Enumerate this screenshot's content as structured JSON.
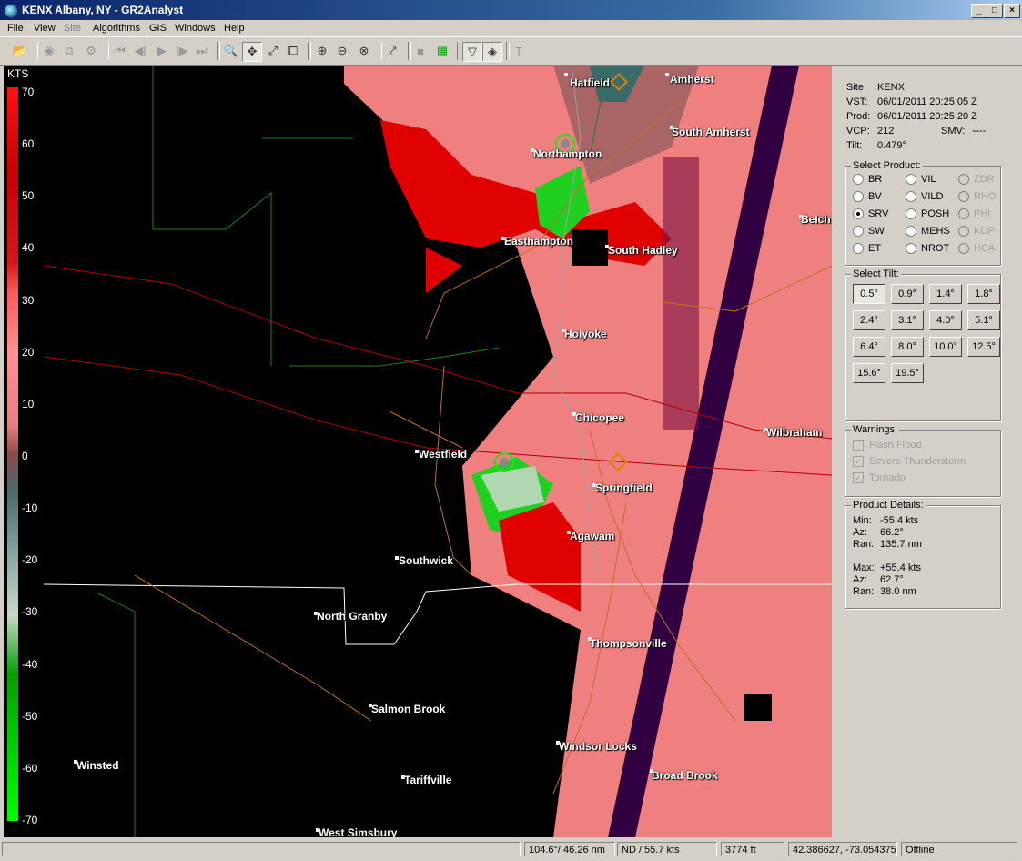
{
  "window": {
    "title": "KENX Albany, NY - GR2Analyst"
  },
  "menu": [
    "File",
    "View",
    "Site",
    "Algorithms",
    "GIS",
    "Windows",
    "Help"
  ],
  "legend": {
    "unit": "KTS",
    "ticks": [
      "70",
      "60",
      "50",
      "40",
      "30",
      "20",
      "10",
      "0",
      "-10",
      "-20",
      "-30",
      "-40",
      "-50",
      "-60",
      "-70"
    ]
  },
  "cities": [
    "Hatfield",
    "Amherst",
    "South Amherst",
    "Northampton",
    "Belch",
    "Easthampton",
    "South Hadley",
    "Holyoke",
    "Chicopee",
    "Wilbraham",
    "Westfield",
    "Springfield",
    "Agawam",
    "Southwick",
    "North Granby",
    "Thompsonville",
    "Salmon Brook",
    "Winsted",
    "Windsor Locks",
    "Tariffville",
    "Broad Brook",
    "West Simsbury"
  ],
  "info": {
    "site_label": "Site:",
    "site": "KENX",
    "vst_label": "VST:",
    "vst": "06/01/2011  20:25:05 Z",
    "prod_label": "Prod:",
    "prod": "06/01/2011  20:25:20 Z",
    "vcp_label": "VCP:",
    "vcp": "212",
    "smv_label": "SMV:",
    "smv": "----",
    "tilt_label": "Tilt:",
    "tilt": "0.479°"
  },
  "select_product": {
    "title": "Select Product:",
    "options": [
      {
        "label": "BR",
        "state": "normal"
      },
      {
        "label": "VIL",
        "state": "normal"
      },
      {
        "label": "ZDR",
        "state": "disabled"
      },
      {
        "label": "BV",
        "state": "normal"
      },
      {
        "label": "VILD",
        "state": "normal"
      },
      {
        "label": "RHO",
        "state": "disabled"
      },
      {
        "label": "SRV",
        "state": "selected"
      },
      {
        "label": "POSH",
        "state": "normal"
      },
      {
        "label": "PHI",
        "state": "disabled"
      },
      {
        "label": "SW",
        "state": "normal"
      },
      {
        "label": "MEHS",
        "state": "normal"
      },
      {
        "label": "KDP",
        "state": "disabled"
      },
      {
        "label": "ET",
        "state": "normal"
      },
      {
        "label": "NROT",
        "state": "normal"
      },
      {
        "label": "HCA",
        "state": "disabled"
      }
    ]
  },
  "select_tilt": {
    "title": "Select Tilt:",
    "tilts": [
      "0.5°",
      "0.9°",
      "1.4°",
      "1.8°",
      "2.4°",
      "3.1°",
      "4.0°",
      "5.1°",
      "6.4°",
      "8.0°",
      "10.0°",
      "12.5°",
      "15.6°",
      "19.5°"
    ],
    "selected": "0.5°"
  },
  "warnings": {
    "title": "Warnings:",
    "items": [
      {
        "label": "Flash Flood",
        "checked": false
      },
      {
        "label": "Severe Thunderstorm",
        "checked": true
      },
      {
        "label": "Tornado",
        "checked": true
      }
    ]
  },
  "product_details": {
    "title": "Product Details:",
    "min_label": "Min:",
    "min": "-55.4 kts",
    "az1_label": "Az:",
    "az1": "66.2°",
    "ran1_label": "Ran:",
    "ran1": "135.7 nm",
    "max_label": "Max:",
    "max": "+55.4 kts",
    "az2_label": "Az:",
    "az2": "62.7°",
    "ran2_label": "Ran:",
    "ran2": "38.0 nm"
  },
  "status": {
    "bearing": "104.6°/ 46.26 nm",
    "value": "ND / 55.7 kts",
    "height": "3774 ft",
    "coords": "42.386627, -73.054375",
    "mode": "Offline"
  },
  "colors": {
    "positive": "#f08080",
    "strong_positive": "#e00000",
    "negative": "#00e000",
    "gate": "#300040"
  }
}
